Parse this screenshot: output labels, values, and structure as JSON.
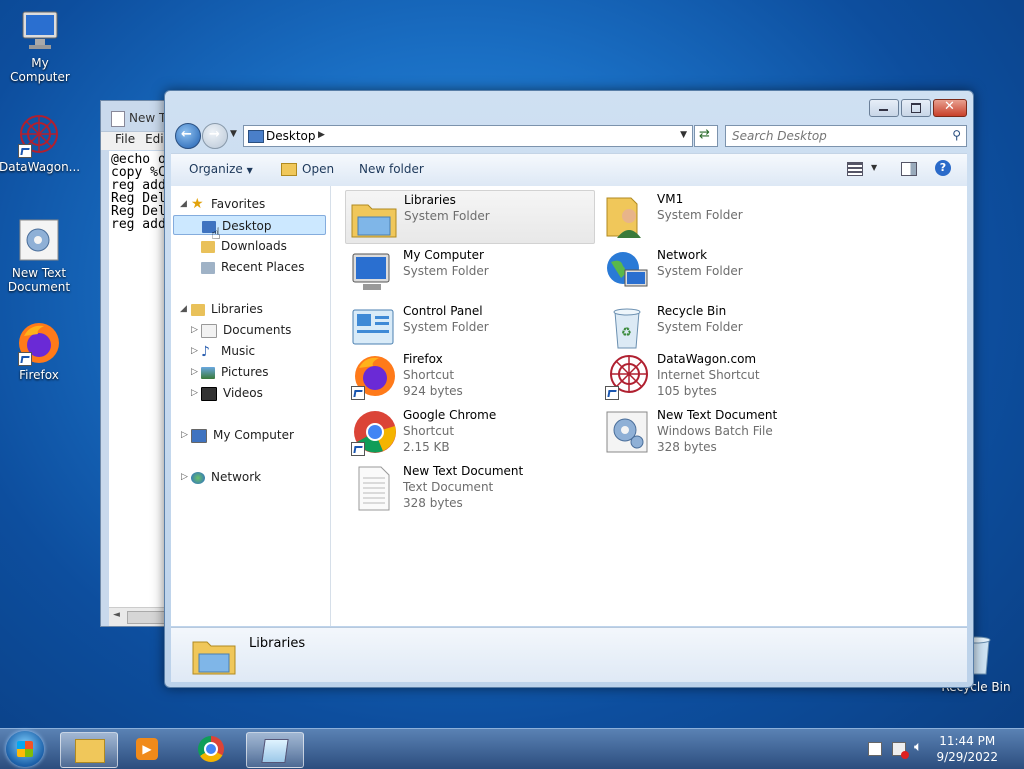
{
  "desktop": {
    "icons": [
      {
        "label": "My Computer"
      },
      {
        "label": "DataWagon..."
      },
      {
        "label": "New Text Document"
      },
      {
        "label": "Firefox"
      },
      {
        "label": "Recycle Bin"
      }
    ]
  },
  "notepad": {
    "title": "New T",
    "menu": [
      "File",
      "Edi"
    ],
    "lines": [
      "@echo o",
      "copy %C",
      "reg add",
      "Reg Del",
      "Reg Del",
      "reg add"
    ]
  },
  "explorer": {
    "address": "Desktop",
    "search_placeholder": "Search Desktop",
    "toolbar": {
      "organize": "Organize",
      "open": "Open",
      "new_folder": "New folder"
    },
    "nav": {
      "favorites": "Favorites",
      "favorites_items": [
        "Desktop",
        "Downloads",
        "Recent Places"
      ],
      "libraries": "Libraries",
      "libraries_items": [
        "Documents",
        "Music",
        "Pictures",
        "Videos"
      ],
      "computer": "My Computer",
      "network": "Network"
    },
    "items": [
      {
        "name": "Libraries",
        "type": "System Folder",
        "size": ""
      },
      {
        "name": "VM1",
        "type": "System Folder",
        "size": ""
      },
      {
        "name": "My Computer",
        "type": "System Folder",
        "size": ""
      },
      {
        "name": "Network",
        "type": "System Folder",
        "size": ""
      },
      {
        "name": "Control Panel",
        "type": "System Folder",
        "size": ""
      },
      {
        "name": "Recycle Bin",
        "type": "System Folder",
        "size": ""
      },
      {
        "name": "Firefox",
        "type": "Shortcut",
        "size": "924 bytes"
      },
      {
        "name": "DataWagon.com",
        "type": "Internet Shortcut",
        "size": "105 bytes"
      },
      {
        "name": "Google Chrome",
        "type": "Shortcut",
        "size": "2.15 KB"
      },
      {
        "name": "New Text Document",
        "type": "Windows Batch File",
        "size": "328 bytes"
      },
      {
        "name": "New Text Document",
        "type": "Text Document",
        "size": "328 bytes"
      }
    ],
    "details": {
      "name": "Libraries"
    }
  },
  "taskbar": {
    "time": "11:44 PM",
    "date": "9/29/2022"
  },
  "colors": {
    "accent": "#1a6fc4",
    "selection": "#cce8ff"
  }
}
